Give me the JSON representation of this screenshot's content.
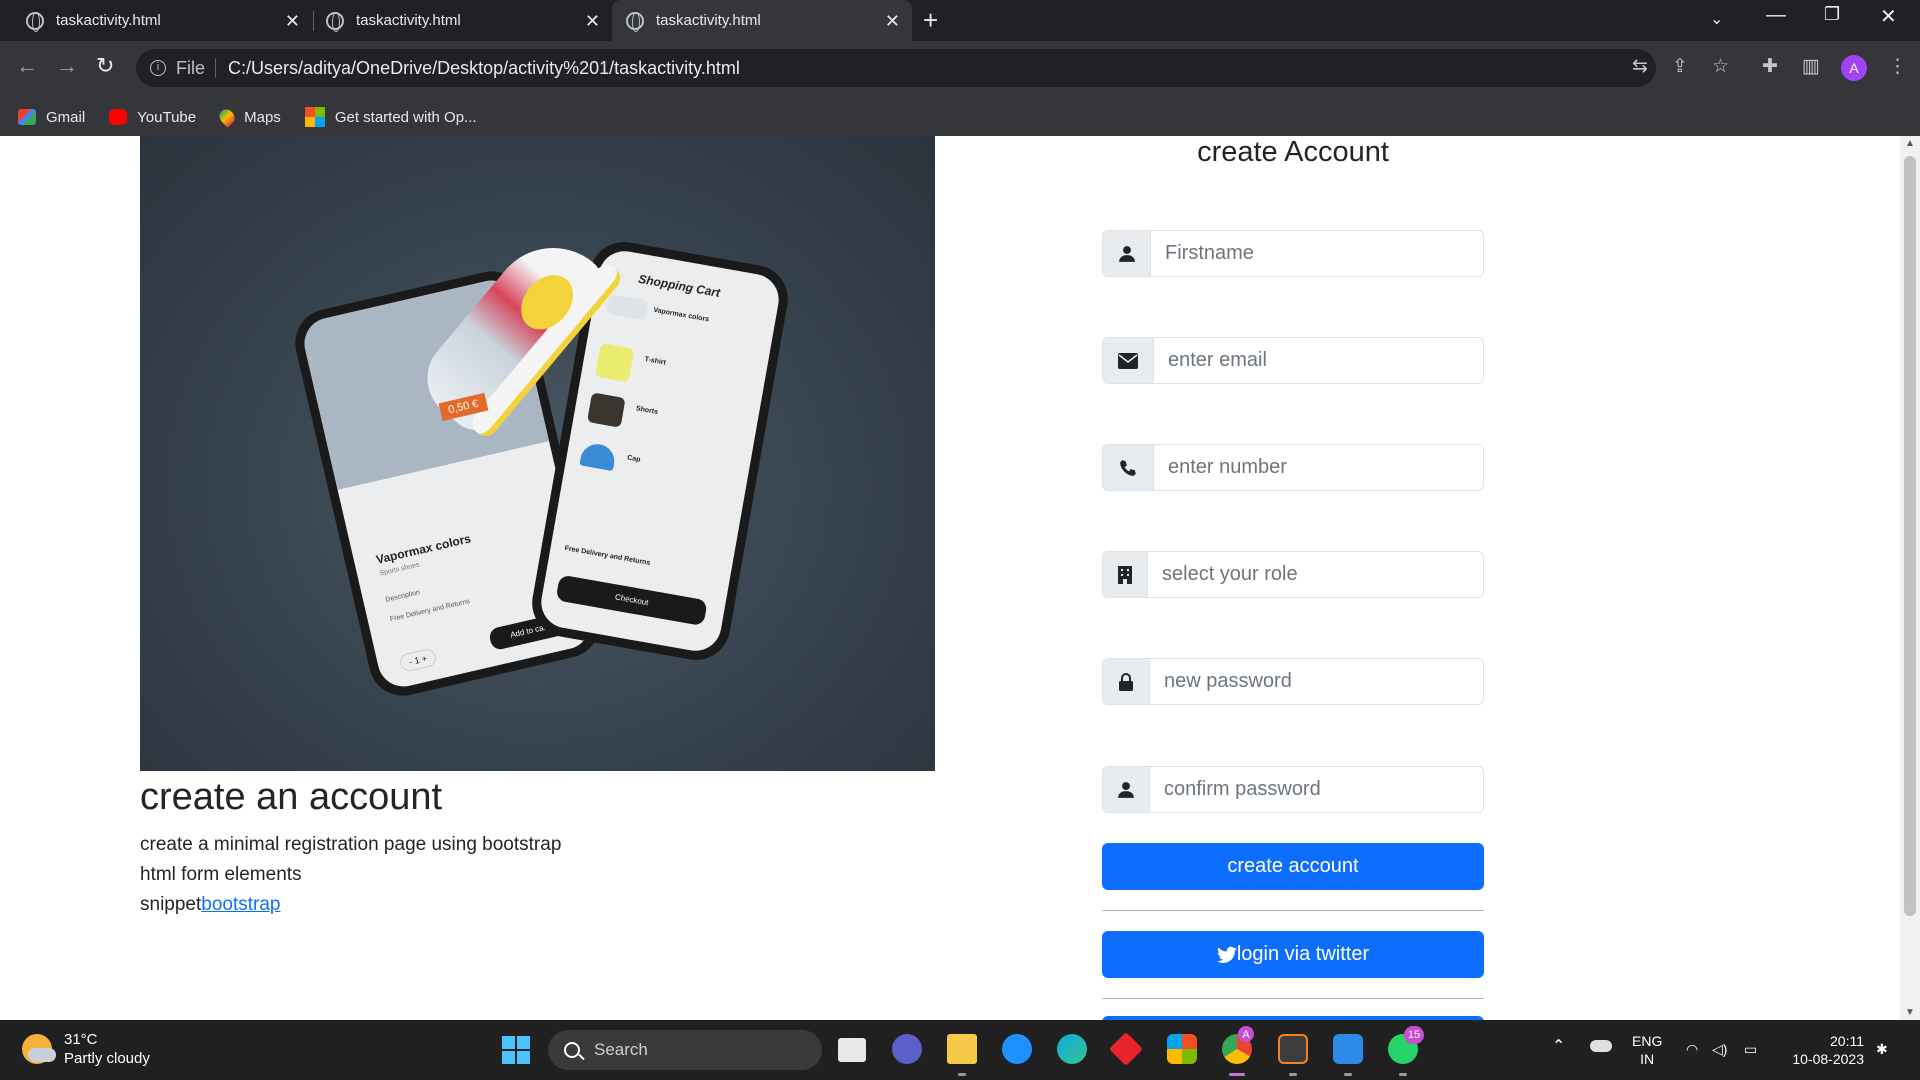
{
  "browser": {
    "tabs": [
      {
        "title": "taskactivity.html"
      },
      {
        "title": "taskactivity.html"
      },
      {
        "title": "taskactivity.html"
      }
    ],
    "url_scheme": "File",
    "url": "C:/Users/aditya/OneDrive/Desktop/activity%201/taskactivity.html",
    "profile_initial": "A",
    "bookmarks": [
      {
        "label": "Gmail"
      },
      {
        "label": "YouTube"
      },
      {
        "label": "Maps"
      },
      {
        "label": "Get started with Op..."
      }
    ]
  },
  "hero_image": {
    "phone_left": {
      "price_tag": "0,50 €",
      "title": "Vapormax colors",
      "subtitle": "Sports shoes",
      "description": "Description",
      "delivery": "Free Delivery and Returns",
      "qty": "-   1   +",
      "cta": "Add to cart"
    },
    "phone_right": {
      "title": "Shopping Cart",
      "items": [
        "Vapormax colors",
        "T-shirt",
        "Shorts",
        "Cap"
      ],
      "delivery": "Free Delivery and Returns",
      "cta": "Checkout"
    }
  },
  "left": {
    "heading": "create an account",
    "line1": "create a minimal registration page using bootstrap",
    "line2": "html form elements",
    "line3_text": "snippet",
    "line3_link": "bootstrap"
  },
  "form": {
    "title": "create Account",
    "fields": [
      {
        "placeholder": "Firstname",
        "icon": "user-icon"
      },
      {
        "placeholder": "enter email",
        "icon": "envelope-icon"
      },
      {
        "placeholder": "enter number",
        "icon": "phone-icon"
      },
      {
        "placeholder": "select your role",
        "icon": "building-icon"
      },
      {
        "placeholder": "new password",
        "icon": "lock-icon"
      },
      {
        "placeholder": "confirm password",
        "icon": "user-icon"
      }
    ],
    "submit_label": "create account",
    "twitter_label": "login via twitter"
  },
  "taskbar": {
    "temperature": "31°C",
    "weather": "Partly cloudy",
    "search_label": "Search",
    "whatsapp_badge": "15",
    "chrome_badge": "A",
    "lang_top": "ENG",
    "lang_bottom": "IN",
    "time": "20:11",
    "date": "10-08-2023"
  },
  "colors": {
    "primary": "#0d6efd",
    "tabbar": "#202124",
    "toolbar": "#35363a",
    "taskbar": "#202020"
  }
}
